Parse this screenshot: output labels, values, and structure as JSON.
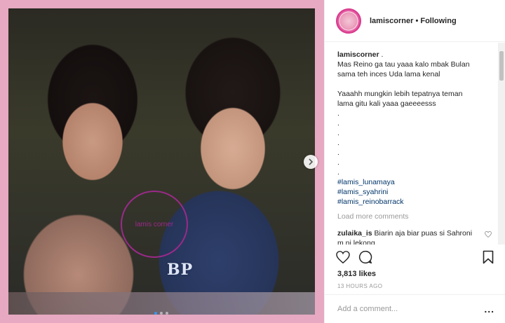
{
  "post": {
    "username": "lamiscorner",
    "follow_status": "• Following",
    "caption_username": "lamiscorner",
    "caption_suffix": " .",
    "caption_lines": [
      "Mas Reino ga tau yaaa kalo mbak Bulan",
      "sama teh inces Uda lama kenal",
      "",
      "Yaaahh mungkin lebih tepatnya teman",
      "lama gitu kali yaaa gaeeeesss",
      ".",
      ".",
      ".",
      ".",
      ".",
      ".",
      "."
    ],
    "hashtags": [
      "#lamis_lunamaya",
      "#lamis_syahrini",
      "#lamis_reinobarrack"
    ],
    "load_more": "Load more comments",
    "comments": [
      {
        "username": "zulaika_is",
        "text": " Biarin aja biar puas si Sahroni m ni lekong."
      }
    ],
    "likes": "3,813 likes",
    "timestamp": "13 HOURS AGO",
    "add_comment_placeholder": "Add a comment...",
    "more_options": "..."
  },
  "media": {
    "watermark_text": "lamis corner",
    "badge_text": "BP",
    "slide_count": 3,
    "active_slide": 0
  },
  "colors": {
    "frame_pink": "#e7a9c1",
    "link_blue": "#003569",
    "accent_blue": "#3897f0"
  },
  "icons": [
    "chevron-right-icon",
    "heart-icon",
    "comment-icon",
    "bookmark-icon"
  ]
}
